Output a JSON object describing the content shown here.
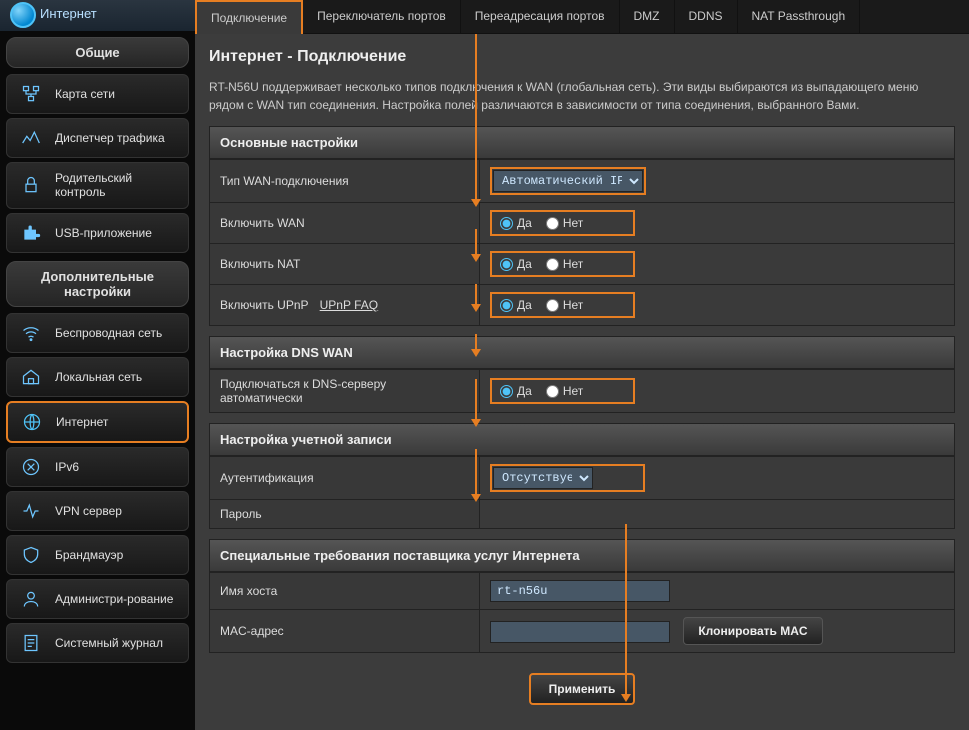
{
  "sidebar": {
    "top_label": "Интернет",
    "section_general": "Общие",
    "section_advanced": "Дополнительные настройки",
    "general_items": [
      {
        "label": "Карта сети"
      },
      {
        "label": "Диспетчер трафика"
      },
      {
        "label": "Родительский контроль"
      },
      {
        "label": "USB-приложение"
      }
    ],
    "advanced_items": [
      {
        "label": "Беспроводная сеть"
      },
      {
        "label": "Локальная сеть"
      },
      {
        "label": "Интернет",
        "active": true
      },
      {
        "label": "IPv6"
      },
      {
        "label": "VPN сервер"
      },
      {
        "label": "Брандмауэр"
      },
      {
        "label": "Администри-рование"
      },
      {
        "label": "Системный журнал"
      }
    ]
  },
  "tabs": [
    {
      "label": "Подключение",
      "active": true
    },
    {
      "label": "Переключатель портов"
    },
    {
      "label": "Переадресация портов"
    },
    {
      "label": "DMZ"
    },
    {
      "label": "DDNS"
    },
    {
      "label": "NAT Passthrough"
    }
  ],
  "page": {
    "title": "Интернет - Подключение",
    "desc": "RT-N56U поддерживает несколько типов подключения к WAN (глобальная сеть). Эти виды выбираются из выпадающего меню рядом с WAN тип соединения. Настройка полей различаются в зависимости от типа соединения, выбранного Вами."
  },
  "sections": {
    "basic": "Основные настройки",
    "dns": "Настройка DNS WAN",
    "account": "Настройка учетной записи",
    "isp": "Специальные требования поставщика услуг Интернета"
  },
  "labels": {
    "wan_type": "Тип WAN-подключения",
    "enable_wan": "Включить WAN",
    "enable_nat": "Включить NAT",
    "enable_upnp": "Включить UPnP",
    "upnp_faq": "UPnP  FAQ",
    "dns_auto": "Подключаться к DNS-серверу автоматически",
    "auth": "Аутентификация",
    "password": "Пароль",
    "hostname": "Имя хоста",
    "mac": "MAC-адрес",
    "yes": "Да",
    "no": "Нет"
  },
  "values": {
    "wan_type": "Автоматический IP",
    "enable_wan": "yes",
    "enable_nat": "yes",
    "enable_upnp": "yes",
    "dns_auto": "yes",
    "auth": "Отсутствует",
    "hostname": "rt-n56u",
    "mac": ""
  },
  "buttons": {
    "clone_mac": "Клонировать MAC",
    "apply": "Применить"
  }
}
